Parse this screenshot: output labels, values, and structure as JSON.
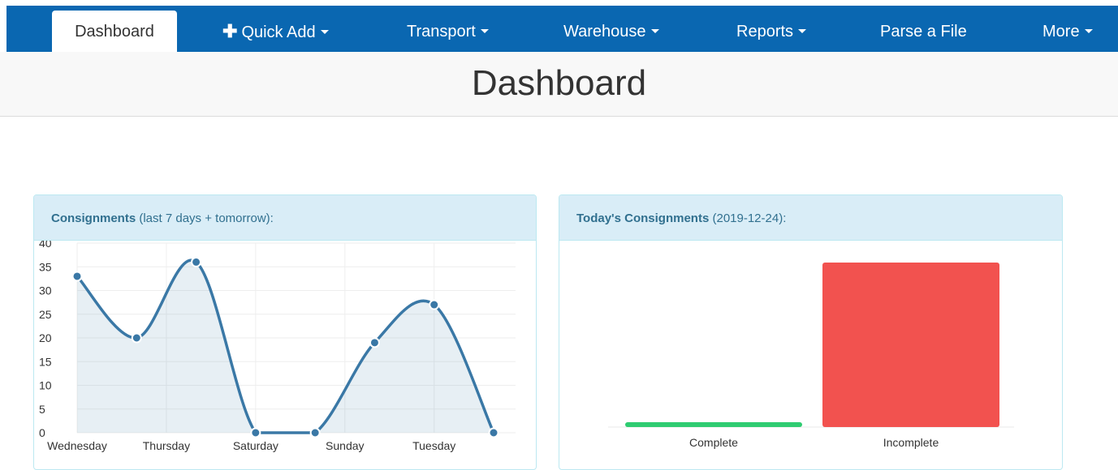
{
  "nav": {
    "dashboard": "Dashboard",
    "quick_add": "Quick Add",
    "transport": "Transport",
    "warehouse": "Warehouse",
    "reports": "Reports",
    "parse_file": "Parse a File",
    "more": "More"
  },
  "page": {
    "title": "Dashboard"
  },
  "panels": {
    "left": {
      "title": "Consignments",
      "subtitle": "(last 7 days + tomorrow):"
    },
    "right": {
      "title": "Today's Consignments",
      "subtitle": "(2019-12-24):"
    }
  },
  "colors": {
    "navbar": "#0a67b1",
    "line": "#3a78a6",
    "complete": "#2ecc71",
    "incomplete": "#f2524f"
  },
  "chart_data": [
    {
      "type": "line",
      "x_tick_labels": [
        "Wednesday",
        "Thursday",
        "Saturday",
        "Sunday",
        "Tuesday"
      ],
      "values": [
        33,
        20,
        36,
        0,
        0,
        19,
        27,
        0
      ],
      "y_ticks": [
        "40",
        "35",
        "30",
        "25",
        "20",
        "15",
        "10",
        "5",
        "0"
      ],
      "ylim": [
        0,
        40
      ],
      "grid": true,
      "area_fill": true
    },
    {
      "type": "bar",
      "categories": [
        "Complete",
        "Incomplete"
      ],
      "values": [
        1,
        34
      ],
      "colors": [
        "#2ecc71",
        "#f2524f"
      ]
    }
  ]
}
